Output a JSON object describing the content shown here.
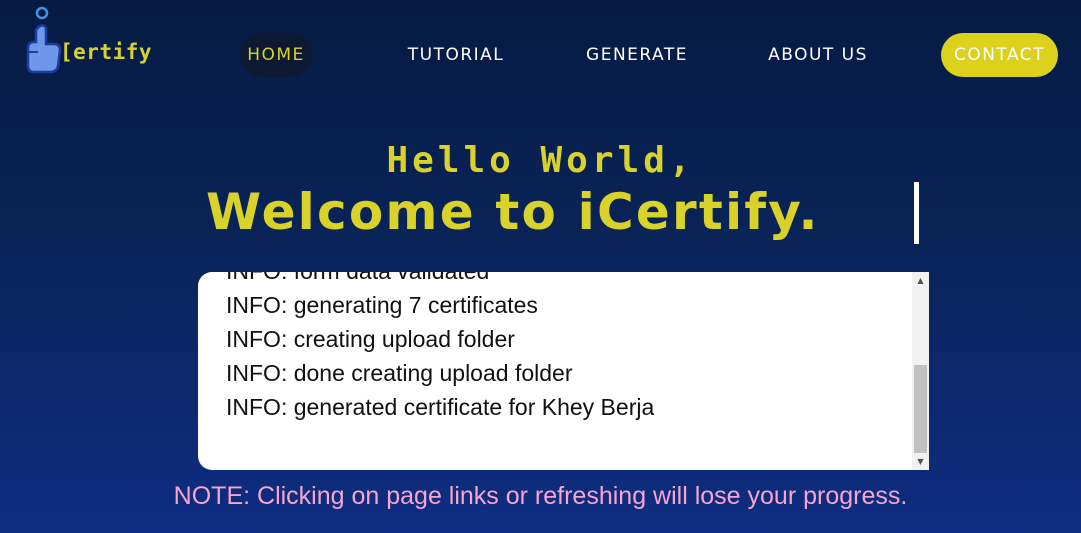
{
  "brand": {
    "logo_text": "ertify",
    "logo_letter": "[",
    "accent_color": "#d8d22a"
  },
  "nav": {
    "items": [
      {
        "label": "HOME",
        "active": true
      },
      {
        "label": "TUTORIAL"
      },
      {
        "label": "GENERATE"
      },
      {
        "label": "ABOUT US"
      },
      {
        "label": "CONTACT",
        "highlight": true
      }
    ]
  },
  "hero": {
    "line1": "Hello World,",
    "line2": "Welcome to iCertify."
  },
  "log": {
    "lines": [
      "INFO: form data validated",
      "INFO: generating 7 certificates",
      "INFO: creating upload folder",
      "INFO: done creating upload folder",
      "INFO: generated certificate for Khey Berja"
    ],
    "scroll_up_icon": "arrow-up-icon",
    "scroll_down_icon": "arrow-down-icon"
  },
  "note": {
    "text": "NOTE: Clicking on page links or refreshing will lose your progress.",
    "color": "#f7a5cf"
  }
}
